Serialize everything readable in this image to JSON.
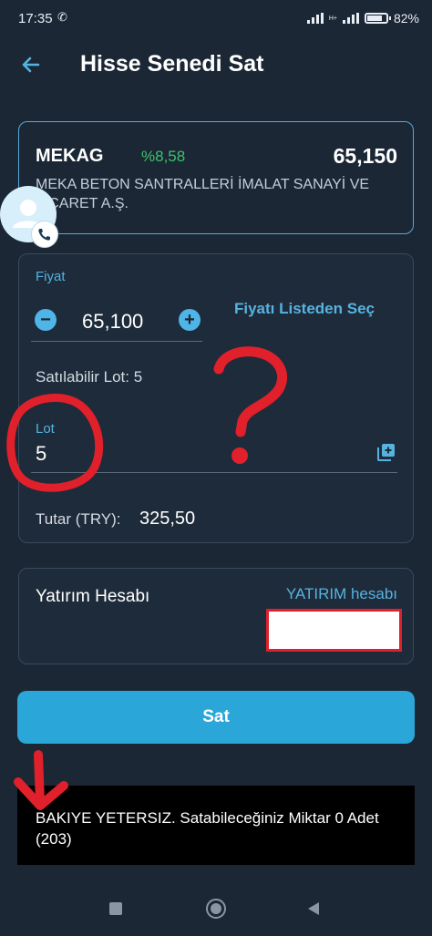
{
  "status_bar": {
    "time": "17:35",
    "network": "H+",
    "battery": "82%",
    "battery_level": 0.82
  },
  "header": {
    "title": "Hisse Senedi Sat",
    "back_icon": "arrow-left-icon"
  },
  "stock": {
    "symbol": "MEKAG",
    "change": "%8,58",
    "price": "65,150",
    "name": "MEKA BETON SANTRALLERİ İMALAT SANAYİ VE TİCARET A.Ş.",
    "change_color": "#3cc46b"
  },
  "order_form": {
    "price_label": "Fiyat",
    "price_value": "65,100",
    "select_from_list": "Fiyatı Listeden Seç",
    "sellable_lot": "Satılabilir Lot: 5",
    "lot_label": "Lot",
    "lot_value": "5",
    "amount_label": "Tutar (TRY):",
    "amount_value": "325,50"
  },
  "account": {
    "label": "Yatırım Hesabı",
    "type": "YATIRIM hesabı"
  },
  "sell_button": {
    "label": "Sat"
  },
  "error": {
    "message": "BAKIYE YETERSIZ. Satabileceğiniz Miktar 0 Adet (203)"
  },
  "colors": {
    "background": "#1b2735",
    "accent": "#56b3e0",
    "button": "#2aa6d9",
    "annotation": "#e0202a"
  }
}
